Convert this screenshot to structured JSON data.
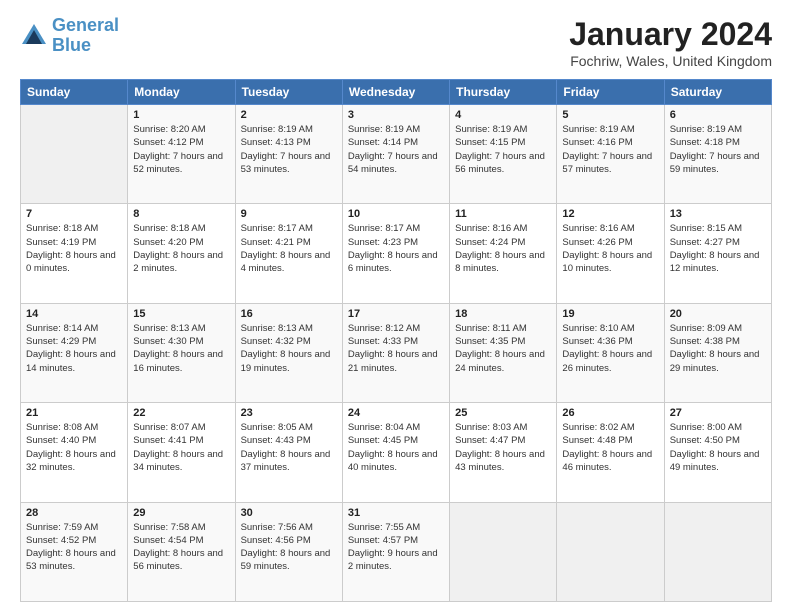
{
  "header": {
    "logo_line1": "General",
    "logo_line2": "Blue",
    "month_title": "January 2024",
    "location": "Fochriw, Wales, United Kingdom"
  },
  "days_header": [
    "Sunday",
    "Monday",
    "Tuesday",
    "Wednesday",
    "Thursday",
    "Friday",
    "Saturday"
  ],
  "weeks": [
    [
      {
        "day": "",
        "sunrise": "",
        "sunset": "",
        "daylight": ""
      },
      {
        "day": "1",
        "sunrise": "Sunrise: 8:20 AM",
        "sunset": "Sunset: 4:12 PM",
        "daylight": "Daylight: 7 hours and 52 minutes."
      },
      {
        "day": "2",
        "sunrise": "Sunrise: 8:19 AM",
        "sunset": "Sunset: 4:13 PM",
        "daylight": "Daylight: 7 hours and 53 minutes."
      },
      {
        "day": "3",
        "sunrise": "Sunrise: 8:19 AM",
        "sunset": "Sunset: 4:14 PM",
        "daylight": "Daylight: 7 hours and 54 minutes."
      },
      {
        "day": "4",
        "sunrise": "Sunrise: 8:19 AM",
        "sunset": "Sunset: 4:15 PM",
        "daylight": "Daylight: 7 hours and 56 minutes."
      },
      {
        "day": "5",
        "sunrise": "Sunrise: 8:19 AM",
        "sunset": "Sunset: 4:16 PM",
        "daylight": "Daylight: 7 hours and 57 minutes."
      },
      {
        "day": "6",
        "sunrise": "Sunrise: 8:19 AM",
        "sunset": "Sunset: 4:18 PM",
        "daylight": "Daylight: 7 hours and 59 minutes."
      }
    ],
    [
      {
        "day": "7",
        "sunrise": "Sunrise: 8:18 AM",
        "sunset": "Sunset: 4:19 PM",
        "daylight": "Daylight: 8 hours and 0 minutes."
      },
      {
        "day": "8",
        "sunrise": "Sunrise: 8:18 AM",
        "sunset": "Sunset: 4:20 PM",
        "daylight": "Daylight: 8 hours and 2 minutes."
      },
      {
        "day": "9",
        "sunrise": "Sunrise: 8:17 AM",
        "sunset": "Sunset: 4:21 PM",
        "daylight": "Daylight: 8 hours and 4 minutes."
      },
      {
        "day": "10",
        "sunrise": "Sunrise: 8:17 AM",
        "sunset": "Sunset: 4:23 PM",
        "daylight": "Daylight: 8 hours and 6 minutes."
      },
      {
        "day": "11",
        "sunrise": "Sunrise: 8:16 AM",
        "sunset": "Sunset: 4:24 PM",
        "daylight": "Daylight: 8 hours and 8 minutes."
      },
      {
        "day": "12",
        "sunrise": "Sunrise: 8:16 AM",
        "sunset": "Sunset: 4:26 PM",
        "daylight": "Daylight: 8 hours and 10 minutes."
      },
      {
        "day": "13",
        "sunrise": "Sunrise: 8:15 AM",
        "sunset": "Sunset: 4:27 PM",
        "daylight": "Daylight: 8 hours and 12 minutes."
      }
    ],
    [
      {
        "day": "14",
        "sunrise": "Sunrise: 8:14 AM",
        "sunset": "Sunset: 4:29 PM",
        "daylight": "Daylight: 8 hours and 14 minutes."
      },
      {
        "day": "15",
        "sunrise": "Sunrise: 8:13 AM",
        "sunset": "Sunset: 4:30 PM",
        "daylight": "Daylight: 8 hours and 16 minutes."
      },
      {
        "day": "16",
        "sunrise": "Sunrise: 8:13 AM",
        "sunset": "Sunset: 4:32 PM",
        "daylight": "Daylight: 8 hours and 19 minutes."
      },
      {
        "day": "17",
        "sunrise": "Sunrise: 8:12 AM",
        "sunset": "Sunset: 4:33 PM",
        "daylight": "Daylight: 8 hours and 21 minutes."
      },
      {
        "day": "18",
        "sunrise": "Sunrise: 8:11 AM",
        "sunset": "Sunset: 4:35 PM",
        "daylight": "Daylight: 8 hours and 24 minutes."
      },
      {
        "day": "19",
        "sunrise": "Sunrise: 8:10 AM",
        "sunset": "Sunset: 4:36 PM",
        "daylight": "Daylight: 8 hours and 26 minutes."
      },
      {
        "day": "20",
        "sunrise": "Sunrise: 8:09 AM",
        "sunset": "Sunset: 4:38 PM",
        "daylight": "Daylight: 8 hours and 29 minutes."
      }
    ],
    [
      {
        "day": "21",
        "sunrise": "Sunrise: 8:08 AM",
        "sunset": "Sunset: 4:40 PM",
        "daylight": "Daylight: 8 hours and 32 minutes."
      },
      {
        "day": "22",
        "sunrise": "Sunrise: 8:07 AM",
        "sunset": "Sunset: 4:41 PM",
        "daylight": "Daylight: 8 hours and 34 minutes."
      },
      {
        "day": "23",
        "sunrise": "Sunrise: 8:05 AM",
        "sunset": "Sunset: 4:43 PM",
        "daylight": "Daylight: 8 hours and 37 minutes."
      },
      {
        "day": "24",
        "sunrise": "Sunrise: 8:04 AM",
        "sunset": "Sunset: 4:45 PM",
        "daylight": "Daylight: 8 hours and 40 minutes."
      },
      {
        "day": "25",
        "sunrise": "Sunrise: 8:03 AM",
        "sunset": "Sunset: 4:47 PM",
        "daylight": "Daylight: 8 hours and 43 minutes."
      },
      {
        "day": "26",
        "sunrise": "Sunrise: 8:02 AM",
        "sunset": "Sunset: 4:48 PM",
        "daylight": "Daylight: 8 hours and 46 minutes."
      },
      {
        "day": "27",
        "sunrise": "Sunrise: 8:00 AM",
        "sunset": "Sunset: 4:50 PM",
        "daylight": "Daylight: 8 hours and 49 minutes."
      }
    ],
    [
      {
        "day": "28",
        "sunrise": "Sunrise: 7:59 AM",
        "sunset": "Sunset: 4:52 PM",
        "daylight": "Daylight: 8 hours and 53 minutes."
      },
      {
        "day": "29",
        "sunrise": "Sunrise: 7:58 AM",
        "sunset": "Sunset: 4:54 PM",
        "daylight": "Daylight: 8 hours and 56 minutes."
      },
      {
        "day": "30",
        "sunrise": "Sunrise: 7:56 AM",
        "sunset": "Sunset: 4:56 PM",
        "daylight": "Daylight: 8 hours and 59 minutes."
      },
      {
        "day": "31",
        "sunrise": "Sunrise: 7:55 AM",
        "sunset": "Sunset: 4:57 PM",
        "daylight": "Daylight: 9 hours and 2 minutes."
      },
      {
        "day": "",
        "sunrise": "",
        "sunset": "",
        "daylight": ""
      },
      {
        "day": "",
        "sunrise": "",
        "sunset": "",
        "daylight": ""
      },
      {
        "day": "",
        "sunrise": "",
        "sunset": "",
        "daylight": ""
      }
    ]
  ]
}
